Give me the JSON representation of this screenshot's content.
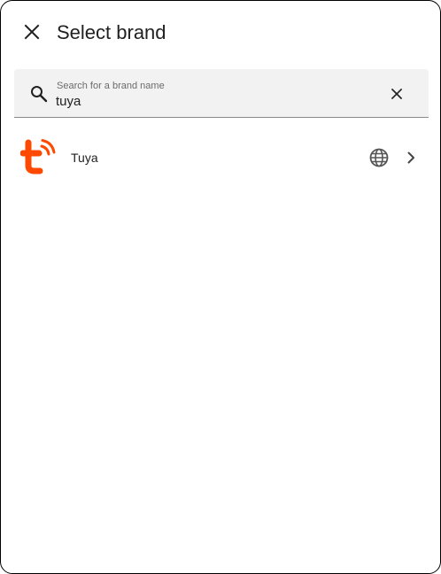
{
  "header": {
    "title": "Select brand",
    "close_icon": "close-icon"
  },
  "search": {
    "label": "Search for a brand name",
    "value": "tuya",
    "search_icon": "search-icon",
    "clear_icon": "clear-icon"
  },
  "brands": [
    {
      "name": "Tuya",
      "logo": "tuya-logo",
      "logo_color": "#ff4800",
      "badge_icon": "globe-icon",
      "nav_icon": "chevron-right-icon"
    }
  ]
}
